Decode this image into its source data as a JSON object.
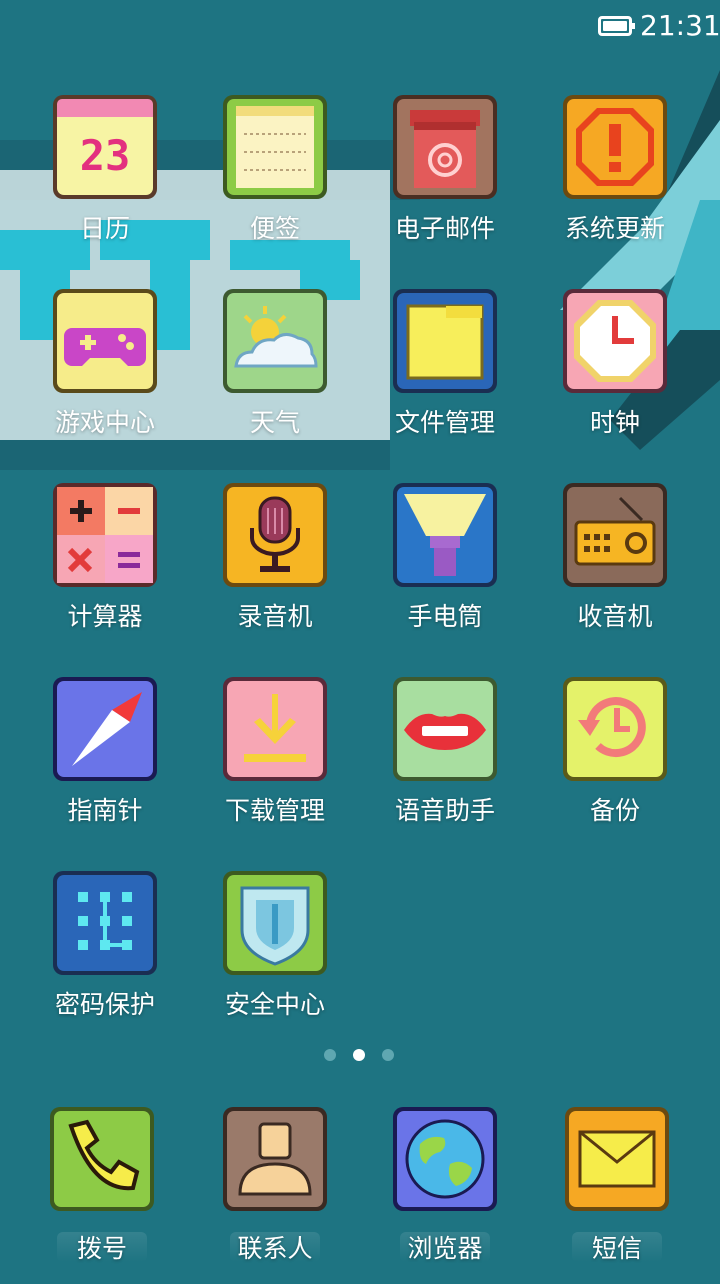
{
  "status_bar": {
    "time": "21:31",
    "battery_icon": "battery-full-icon"
  },
  "apps": [
    {
      "id": "calendar",
      "label": "日历",
      "icon": "calendar-icon",
      "date": "23"
    },
    {
      "id": "notes",
      "label": "便签",
      "icon": "notepad-icon"
    },
    {
      "id": "email",
      "label": "电子邮件",
      "icon": "mailbox-icon"
    },
    {
      "id": "system-update",
      "label": "系统更新",
      "icon": "exclamation-icon"
    },
    {
      "id": "game-center",
      "label": "游戏中心",
      "icon": "gamepad-icon"
    },
    {
      "id": "weather",
      "label": "天气",
      "icon": "weather-icon"
    },
    {
      "id": "file-manager",
      "label": "文件管理",
      "icon": "folder-icon"
    },
    {
      "id": "clock",
      "label": "时钟",
      "icon": "clock-icon"
    },
    {
      "id": "calculator",
      "label": "计算器",
      "icon": "calculator-icon"
    },
    {
      "id": "recorder",
      "label": "录音机",
      "icon": "microphone-icon"
    },
    {
      "id": "flashlight",
      "label": "手电筒",
      "icon": "flashlight-icon"
    },
    {
      "id": "radio",
      "label": "收音机",
      "icon": "radio-icon"
    },
    {
      "id": "compass",
      "label": "指南针",
      "icon": "compass-icon"
    },
    {
      "id": "downloads",
      "label": "下载管理",
      "icon": "download-icon"
    },
    {
      "id": "voice-assistant",
      "label": "语音助手",
      "icon": "lips-icon"
    },
    {
      "id": "backup",
      "label": "备份",
      "icon": "backup-clock-icon"
    },
    {
      "id": "password-protect",
      "label": "密码保护",
      "icon": "keypad-icon"
    },
    {
      "id": "security-center",
      "label": "安全中心",
      "icon": "shield-icon"
    }
  ],
  "page_indicator": {
    "count": 3,
    "active": 2
  },
  "dock": [
    {
      "id": "dialer",
      "label": "拨号",
      "icon": "phone-icon"
    },
    {
      "id": "contacts",
      "label": "联系人",
      "icon": "contact-icon"
    },
    {
      "id": "browser",
      "label": "浏览器",
      "icon": "globe-icon"
    },
    {
      "id": "messages",
      "label": "短信",
      "icon": "envelope-icon"
    }
  ]
}
